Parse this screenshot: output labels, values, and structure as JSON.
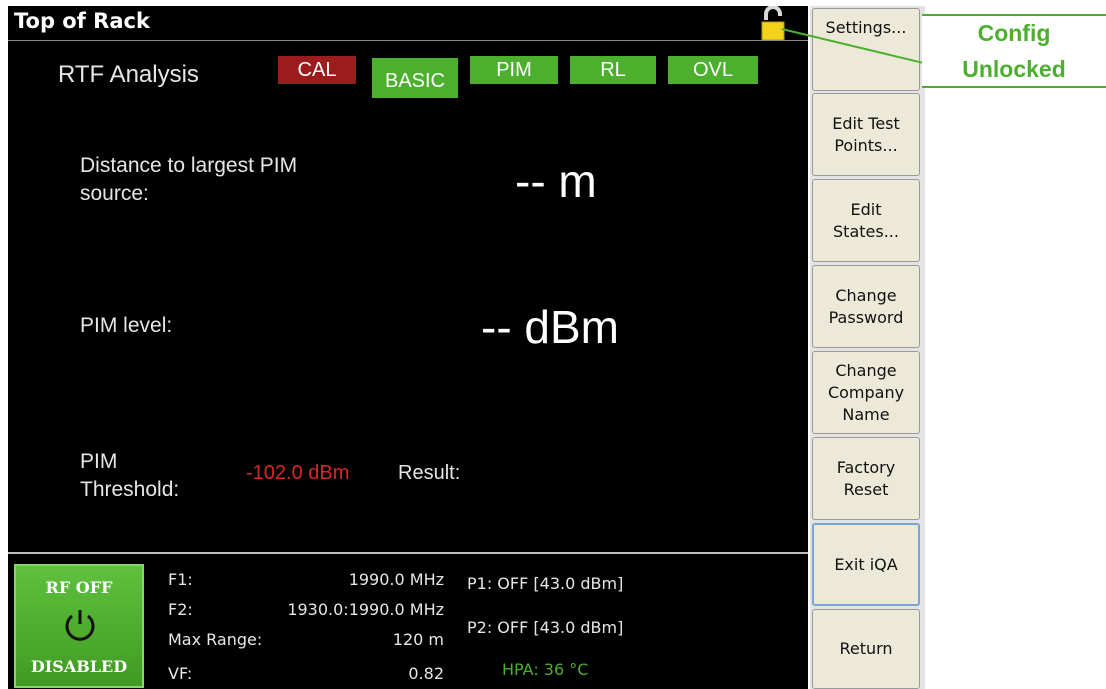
{
  "window": {
    "title": "Top of Rack",
    "lock_icon": "padlock-unlocked-icon"
  },
  "analysis": {
    "title": "RTF Analysis",
    "tags": [
      {
        "label": "CAL",
        "color": "#9b1c1c"
      },
      {
        "label": "BASIC",
        "color": "#4caf2e"
      },
      {
        "label": "PIM",
        "color": "#4caf2e"
      },
      {
        "label": "RL",
        "color": "#4caf2e"
      },
      {
        "label": "OVL",
        "color": "#4caf2e"
      }
    ]
  },
  "measurements": {
    "distance_label_line1": "Distance to largest PIM",
    "distance_label_line2": "source:",
    "distance_value": "-- m",
    "pim_level_label": "PIM level:",
    "pim_level_value": "-- dBm",
    "threshold_label_line1": "PIM",
    "threshold_label_line2": "Threshold:",
    "threshold_value": "-102.0 dBm",
    "threshold_color": "#d62828",
    "result_label": "Result:"
  },
  "status": {
    "rf_state_top": "RF OFF",
    "rf_state_bottom": "DISABLED",
    "rf_icon": "power-icon",
    "f1_label": "F1:",
    "f1_value": "1990.0 MHz",
    "f2_label": "F2:",
    "f2_value": "1930.0:1990.0  MHz",
    "max_range_label": "Max Range:",
    "max_range_value": "120 m",
    "vf_label": "VF:",
    "vf_value": "0.82",
    "p1": "P1: OFF [43.0 dBm]",
    "p2": "P2: OFF [43.0 dBm]",
    "hpa": "HPA: 36 °C",
    "hpa_color": "#4caf2e"
  },
  "sidebar": {
    "buttons": [
      {
        "label": "Settings..."
      },
      {
        "label": "Edit Test\nPoints..."
      },
      {
        "label": "Edit\nStates..."
      },
      {
        "label": "Change\nPassword"
      },
      {
        "label": "Change\nCompany\nName"
      },
      {
        "label": "Factory\nReset"
      },
      {
        "label": "Exit iQA"
      },
      {
        "label": "Return"
      }
    ]
  },
  "callout": {
    "line1": "Config",
    "line2": "Unlocked",
    "color": "#4caf2e"
  }
}
